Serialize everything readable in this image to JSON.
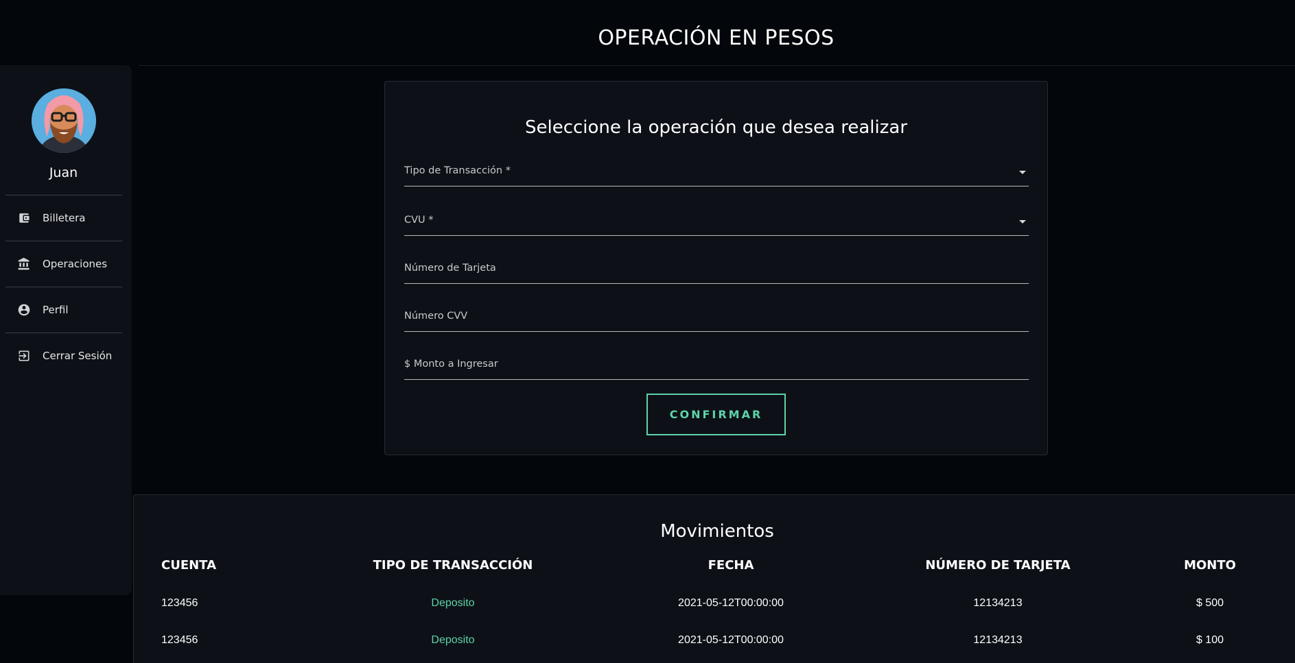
{
  "header": {
    "title": "OPERACIÓN EN PESOS"
  },
  "sidebar": {
    "user_name": "Juan",
    "items": [
      {
        "label": "Billetera",
        "icon": "wallet-icon"
      },
      {
        "label": "Operaciones",
        "icon": "bank-icon"
      },
      {
        "label": "Perfil",
        "icon": "account-circle-icon"
      },
      {
        "label": "Cerrar Sesión",
        "icon": "logout-icon"
      }
    ]
  },
  "form": {
    "title": "Seleccione la operación que desea realizar",
    "fields": [
      {
        "label": "Tipo de Transacción *",
        "type": "select"
      },
      {
        "label": "CVU *",
        "type": "select"
      },
      {
        "label": "Número de Tarjeta",
        "type": "text"
      },
      {
        "label": "Número CVV",
        "type": "text"
      },
      {
        "label": "$ Monto a Ingresar",
        "type": "text"
      }
    ],
    "confirm_label": "CONFIRMAR"
  },
  "movements": {
    "title": "Movimientos",
    "columns": [
      "CUENTA",
      "TIPO DE TRANSACCIÓN",
      "FECHA",
      "NÚMERO DE TARJETA",
      "MONTO"
    ],
    "rows": [
      [
        "123456",
        "Deposito",
        "2021-05-12T00:00:00",
        "12134213",
        "$ 500"
      ],
      [
        "123456",
        "Deposito",
        "2021-05-12T00:00:00",
        "12134213",
        "$ 100"
      ]
    ]
  },
  "colors": {
    "accent": "#5ed3a8",
    "background": "#03060b",
    "panel": "#0d1117"
  }
}
